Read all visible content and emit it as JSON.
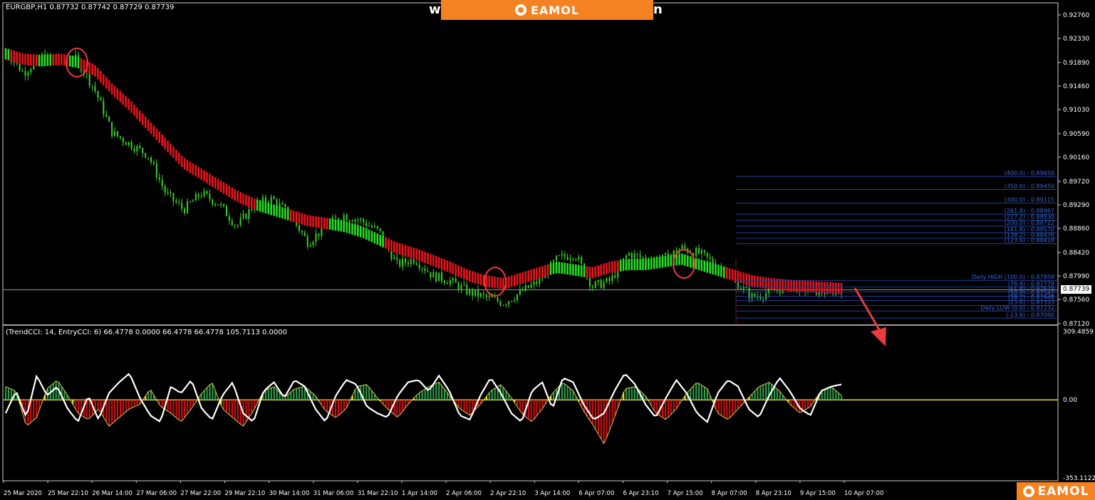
{
  "header": {
    "symbol_info": "EURGBP,H1  0.87732 0.87742 0.87729 0.87739",
    "indicator_info": "(TrendCCI: 14, EntryCCI: 6) 66.4778 0.0000 66.4778 66.4778 105.7113 0.0000"
  },
  "watermark": {
    "left_text": "w",
    "right_text": "n",
    "brand": "EAMOL"
  },
  "colors": {
    "background": "#000000",
    "bull_candle": "#39d02a",
    "ma_bear": "#e8141c",
    "ma_bull": "#25e025",
    "fib_line": "#1f3f9a",
    "fib_text": "#3a66d8",
    "cci_white": "#ffffff",
    "cci_green": "#2a9a4a",
    "cci_red": "#cc1010",
    "cci_yellow": "#f2e020",
    "brand_orange": "#f58220",
    "axis_text": "#ffffff",
    "circle": "#e63c3c"
  },
  "chart_data": [
    {
      "type": "candlestick",
      "title": "EURGBP,H1",
      "ylim": [
        0.8712,
        0.9285
      ],
      "price_ticks": [
        "0.92760",
        "0.92330",
        "0.91890",
        "0.91460",
        "0.91030",
        "0.90590",
        "0.90160",
        "0.89720",
        "0.89290",
        "0.88860",
        "0.88420",
        "0.87990",
        "0.87560",
        "0.87120"
      ],
      "current_price_label": "0.87739",
      "current_price": 0.87739,
      "time_labels": [
        "25 Mar 2020",
        "25 Mar 22:10",
        "26 Mar 14:00",
        "27 Mar 06:00",
        "27 Mar 22:00",
        "29 Mar 22:10",
        "30 Mar 14:00",
        "31 Mar 06:00",
        "31 Mar 22:10",
        "1 Apr 14:00",
        "2 Apr 06:00",
        "2 Apr 22:10",
        "3 Apr 14:00",
        "6 Apr 07:00",
        "6 Apr 23:10",
        "7 Apr 15:00",
        "8 Apr 07:00",
        "8 Apr 23:10",
        "9 Apr 15:00",
        "10 Apr 07:00"
      ],
      "price_path": [
        0.921,
        0.917,
        0.92,
        0.919,
        0.9195,
        0.914,
        0.906,
        0.904,
        0.902,
        0.895,
        0.892,
        0.895,
        0.893,
        0.889,
        0.893,
        0.894,
        0.891,
        0.886,
        0.889,
        0.891,
        0.89,
        0.888,
        0.882,
        0.883,
        0.88,
        0.879,
        0.877,
        0.876,
        0.875,
        0.877,
        0.879,
        0.883,
        0.884,
        0.878,
        0.879,
        0.884,
        0.883,
        0.883,
        0.885,
        0.884,
        0.882,
        0.879,
        0.876,
        0.877,
        0.878,
        0.8775,
        0.877,
        0.8774
      ],
      "ma_path": [
        0.9205,
        0.9195,
        0.9192,
        0.9195,
        0.919,
        0.9175,
        0.914,
        0.911,
        0.9075,
        0.904,
        0.9005,
        0.8985,
        0.8965,
        0.8945,
        0.893,
        0.892,
        0.891,
        0.89,
        0.8895,
        0.889,
        0.888,
        0.8865,
        0.885,
        0.884,
        0.8828,
        0.8815,
        0.88,
        0.879,
        0.8785,
        0.8795,
        0.8805,
        0.8815,
        0.881,
        0.8805,
        0.8815,
        0.882,
        0.882,
        0.8825,
        0.883,
        0.882,
        0.881,
        0.88,
        0.879,
        0.8785,
        0.8782,
        0.878,
        0.8778,
        0.8776
      ],
      "annotations": [
        "circle at 25 Mar 22:10",
        "circle at 3 Apr",
        "circle at 8 Apr",
        "arrow pointing down after 10 Apr"
      ]
    },
    {
      "type": "fibonacci",
      "levels": [
        {
          "label": "(400.0) - 0.89650",
          "price": 0.8981
        },
        {
          "label": "(350.0) - 0.89450",
          "price": 0.8957
        },
        {
          "label": "(300.0) - 0.89115",
          "price": 0.8932
        },
        {
          "label": "(261.8) - 0.88967",
          "price": 0.8912
        },
        {
          "label": "(227.2) - 0.88830",
          "price": 0.8901
        },
        {
          "label": "(200.0) - 0.88722",
          "price": 0.889
        },
        {
          "label": "(161.8) - 0.88570",
          "price": 0.8878
        },
        {
          "label": "(138.2) - 0.88476",
          "price": 0.8868
        },
        {
          "label": "(123.6) - 0.88418",
          "price": 0.8858
        },
        {
          "label": "Daily HIGH (100.0) - 0.87858",
          "price": 0.8791
        },
        {
          "label": "(76.4) - 0.87779",
          "price": 0.8779
        },
        {
          "label": "(61.8) - 0.87679",
          "price": 0.877
        },
        {
          "label": "(50.0) - 0.87542",
          "price": 0.8762
        },
        {
          "label": "(38.2) - 0.87448",
          "price": 0.8754
        },
        {
          "label": "(23.6) - 0.87333",
          "price": 0.8745
        },
        {
          "label": "Daily LOW (0.0) - 0.87232",
          "price": 0.8735
        },
        {
          "label": "(-23.6) - 0.87090",
          "price": 0.8722
        }
      ]
    },
    {
      "type": "bar",
      "title": "TrendCCI / EntryCCI",
      "ylim": [
        -353.1122,
        309.4859
      ],
      "y_ticks": [
        "309.4859",
        "0.00",
        "-353.1122"
      ],
      "trend_cci": [
        60,
        40,
        -120,
        -80,
        50,
        90,
        20,
        -60,
        -90,
        -40,
        -120,
        -80,
        -40,
        -20,
        50,
        -30,
        -60,
        -100,
        -40,
        30,
        80,
        -40,
        -80,
        -120,
        -50,
        40,
        60,
        10,
        50,
        60,
        20,
        -50,
        -80,
        -40,
        60,
        70,
        10,
        -40,
        -80,
        -20,
        30,
        60,
        80,
        20,
        -40,
        -70,
        -20,
        40,
        70,
        10,
        -60,
        -100,
        -40,
        30,
        80,
        40,
        -50,
        -120,
        -200,
        -80,
        50,
        60,
        20,
        -60,
        -90,
        -40,
        30,
        80,
        50,
        -60,
        -90,
        -40,
        10,
        60,
        80,
        40,
        -20,
        -60,
        -30,
        40,
        60,
        20
      ],
      "entry_cci": [
        -60,
        40,
        -80,
        110,
        20,
        60,
        -40,
        -100,
        20,
        -90,
        30,
        80,
        120,
        10,
        -70,
        -100,
        60,
        30,
        90,
        -40,
        -90,
        20,
        80,
        -60,
        -100,
        40,
        80,
        10,
        90,
        60,
        -40,
        -100,
        20,
        90,
        70,
        -30,
        -60,
        -80,
        20,
        80,
        90,
        40,
        110,
        40,
        -70,
        -90,
        20,
        100,
        30,
        -60,
        -100,
        40,
        80,
        -40,
        100,
        80,
        -20,
        -90,
        -60,
        40,
        120,
        70,
        -20,
        -80,
        10,
        90,
        30,
        -60,
        -100,
        30,
        90,
        60,
        -40,
        -80,
        20,
        100,
        40,
        -40,
        -70,
        40,
        60,
        70
      ]
    }
  ]
}
